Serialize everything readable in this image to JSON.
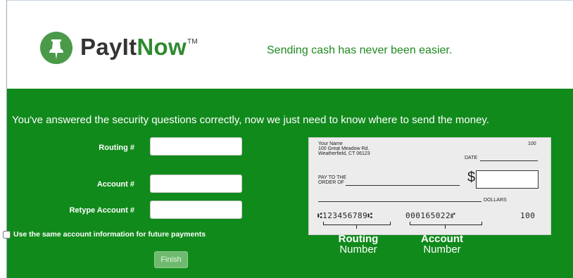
{
  "header": {
    "brand_pay": "Pay",
    "brand_it": "It",
    "brand_now": "Now",
    "brand_tm": "TM",
    "tagline": "Sending cash has never been easier."
  },
  "colors": {
    "brand_green": "#2f8a2f",
    "panel_green": "#118a1c",
    "logo_green": "#4a9a4a"
  },
  "form": {
    "intro": "You've answered the security questions correctly, now we just need to know where to send the money.",
    "routing_label": "Routing #",
    "routing_value": "",
    "account_label": "Account #",
    "account_value": "",
    "retype_label": "Retype Account #",
    "retype_value": "",
    "save_label": "Use the same account information for future payments",
    "save_checked": false,
    "finish_label": "Finish"
  },
  "check": {
    "name": "Your Name",
    "address1": "100 Great Meadow Rd.",
    "address2": "Weatherfield, CT 06123",
    "number": "100",
    "date_label": "DATE",
    "pay_to_1": "PAY TO THE",
    "pay_to_2": "ORDER OF",
    "dollar_sign": "$",
    "dollars_label": "DOLLARS",
    "micr_routing": "⑆123456789⑆",
    "micr_account": "000165022⑈",
    "micr_check": "100"
  },
  "legend": {
    "routing_title": "Routing",
    "routing_sub": "Number",
    "account_title": "Account",
    "account_sub": "Number"
  },
  "icons": {
    "logo": "pushpin-icon"
  }
}
